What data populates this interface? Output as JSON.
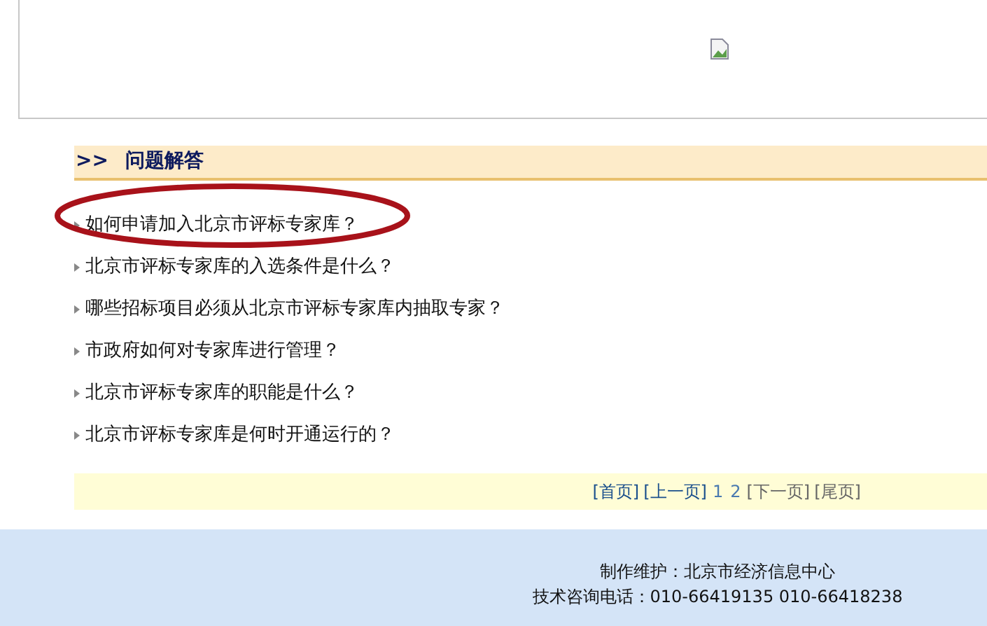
{
  "section": {
    "marker": ">>",
    "title": "问题解答"
  },
  "questions": [
    {
      "text": "如何申请加入北京市评标专家库？",
      "highlighted": true
    },
    {
      "text": "北京市评标专家库的入选条件是什么？",
      "highlighted": false
    },
    {
      "text": "哪些招标项目必须从北京市评标专家库内抽取专家？",
      "highlighted": false
    },
    {
      "text": "市政府如何对专家库进行管理？",
      "highlighted": false
    },
    {
      "text": "北京市评标专家库的职能是什么？",
      "highlighted": false
    },
    {
      "text": "北京市评标专家库是何时开通运行的？",
      "highlighted": false
    }
  ],
  "pager": [
    {
      "kind": "link",
      "text": "[首页]",
      "disabled": false
    },
    {
      "kind": "link",
      "text": "[上一页]",
      "disabled": false
    },
    {
      "kind": "page",
      "text": "1"
    },
    {
      "kind": "page",
      "text": "2"
    },
    {
      "kind": "link",
      "text": "[下一页]",
      "disabled": true
    },
    {
      "kind": "link",
      "text": "[尾页]",
      "disabled": true
    }
  ],
  "footer": {
    "lines": [
      "制作维护：北京市经济信息中心",
      "技术咨询电话：010-66419135 010-66418238"
    ]
  }
}
